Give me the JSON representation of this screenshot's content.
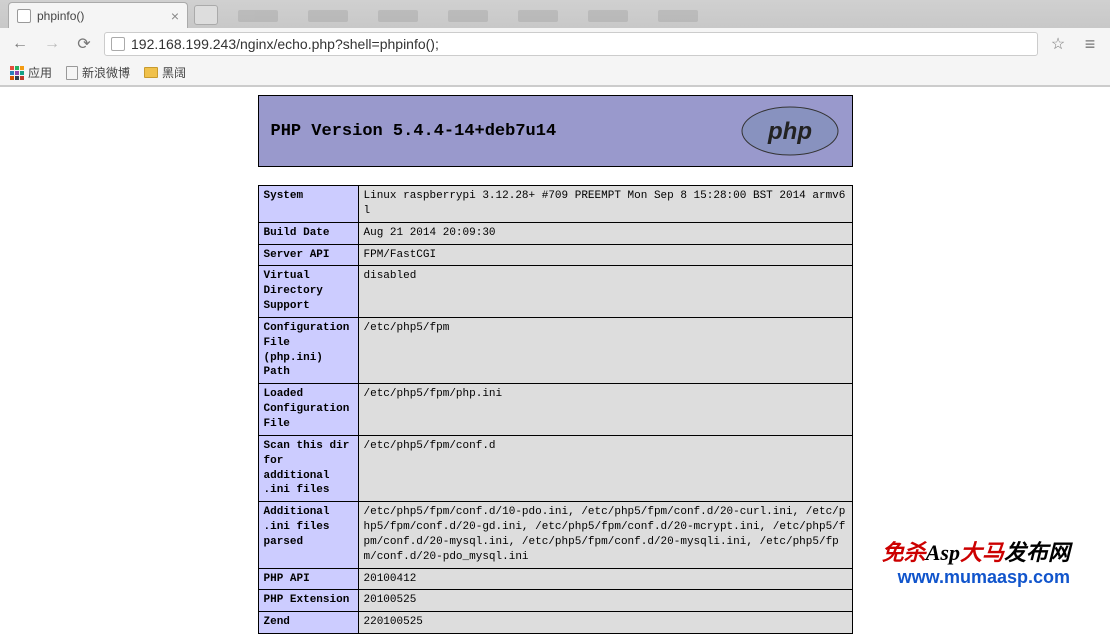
{
  "browser": {
    "tab_title": "phpinfo()",
    "url": "192.168.199.243/nginx/echo.php?shell=phpinfo();",
    "bookmarks": {
      "apps": "应用",
      "weibo": "新浪微博",
      "heikuo": "黑阔"
    }
  },
  "php": {
    "version_label": "PHP Version 5.4.4-14+deb7u14",
    "logo_text": "php",
    "rows": [
      {
        "key": "System",
        "val": "Linux raspberrypi 3.12.28+ #709 PREEMPT Mon Sep 8 15:28:00 BST 2014 armv6l"
      },
      {
        "key": "Build Date",
        "val": "Aug 21 2014 20:09:30"
      },
      {
        "key": "Server API",
        "val": "FPM/FastCGI"
      },
      {
        "key": "Virtual Directory Support",
        "val": "disabled"
      },
      {
        "key": "Configuration File (php.ini) Path",
        "val": "/etc/php5/fpm"
      },
      {
        "key": "Loaded Configuration File",
        "val": "/etc/php5/fpm/php.ini"
      },
      {
        "key": "Scan this dir for additional .ini files",
        "val": "/etc/php5/fpm/conf.d"
      },
      {
        "key": "Additional .ini files parsed",
        "val": "/etc/php5/fpm/conf.d/10-pdo.ini, /etc/php5/fpm/conf.d/20-curl.ini, /etc/php5/fpm/conf.d/20-gd.ini, /etc/php5/fpm/conf.d/20-mcrypt.ini, /etc/php5/fpm/conf.d/20-mysql.ini, /etc/php5/fpm/conf.d/20-mysqli.ini, /etc/php5/fpm/conf.d/20-pdo_mysql.ini"
      },
      {
        "key": "PHP API",
        "val": "20100412"
      },
      {
        "key": "PHP Extension",
        "val": "20100525"
      },
      {
        "key": "Zend",
        "val": "220100525"
      }
    ]
  },
  "watermark": {
    "line1_a": "免杀",
    "line1_b": "Asp",
    "line1_c": "大马",
    "line1_d": "发布网",
    "line2": "www.mumaasp.com"
  }
}
